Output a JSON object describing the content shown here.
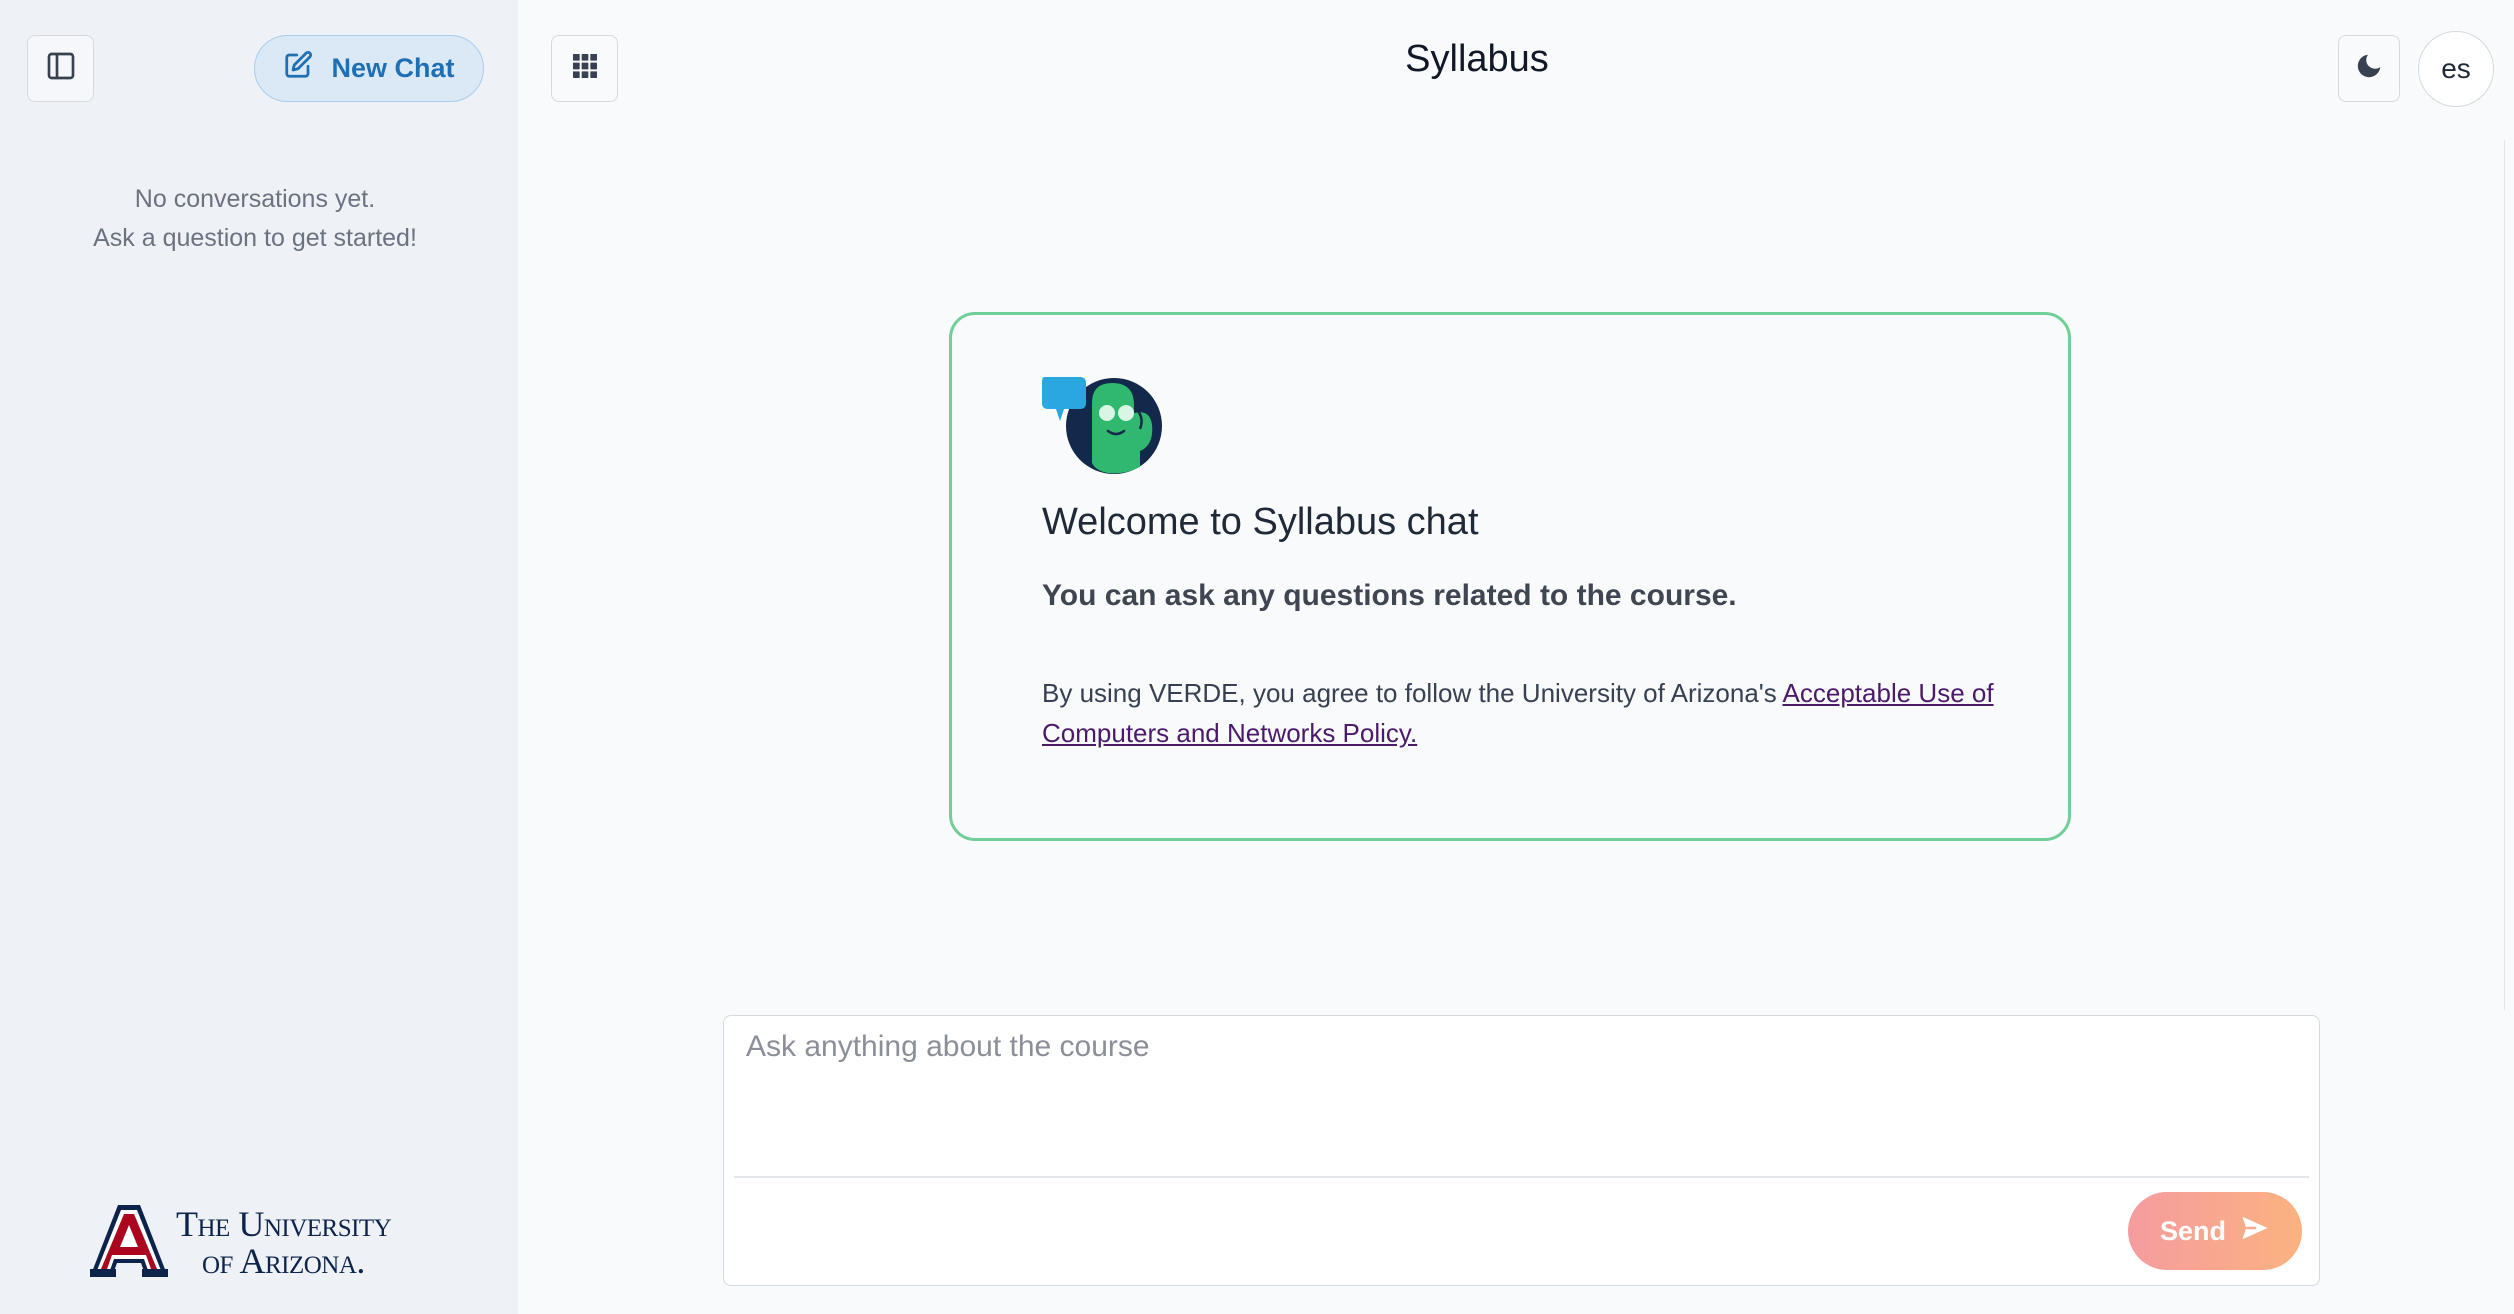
{
  "sidebar": {
    "new_chat_label": "New Chat",
    "empty_line1": "No conversations yet.",
    "empty_line2": "Ask a question to get started!",
    "logo_line1": "The University",
    "logo_line2": "of Arizona."
  },
  "header": {
    "title": "Syllabus",
    "avatar_initials": "es"
  },
  "welcome": {
    "title": "Welcome to Syllabus chat",
    "subtitle": "You can ask any questions related to the course.",
    "policy_prefix": "By using VERDE, you agree to follow the University of Arizona's ",
    "policy_link": "Acceptable Use of Computers and Networks Policy."
  },
  "composer": {
    "placeholder": "Ask anything about the course",
    "send_label": "Send"
  },
  "icons": {
    "sidebar_toggle": "sidebar-panel-icon",
    "new_chat": "edit-square-icon",
    "apps": "grid-icon",
    "theme": "moon-icon",
    "send": "paper-plane-icon"
  },
  "colors": {
    "accent_blue": "#1f6fb5",
    "card_border": "#6fcf97",
    "send_gradient_start": "#f59ca0",
    "send_gradient_end": "#fbb27f",
    "arizona_navy": "#0c234b",
    "arizona_red": "#ab0520"
  }
}
